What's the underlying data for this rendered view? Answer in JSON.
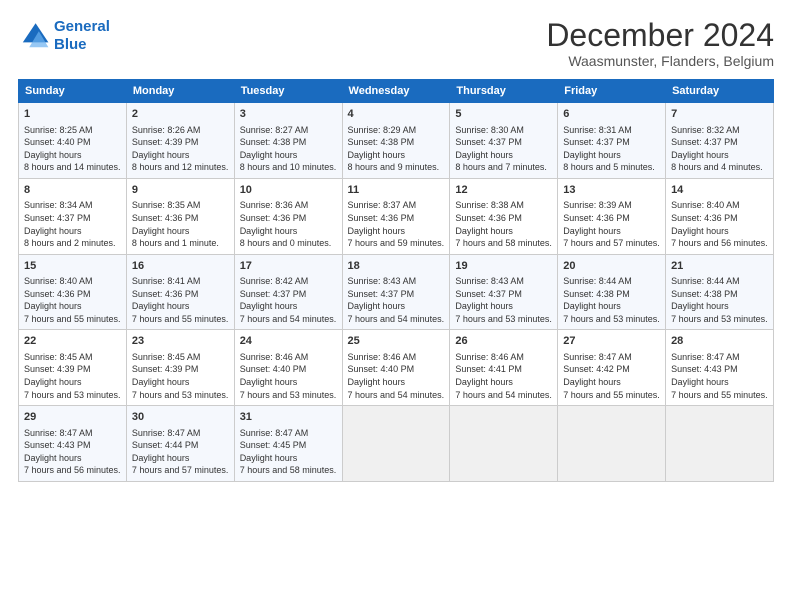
{
  "logo": {
    "line1": "General",
    "line2": "Blue"
  },
  "title": "December 2024",
  "subtitle": "Waasmunster, Flanders, Belgium",
  "days_of_week": [
    "Sunday",
    "Monday",
    "Tuesday",
    "Wednesday",
    "Thursday",
    "Friday",
    "Saturday"
  ],
  "weeks": [
    [
      {
        "day": "1",
        "sunrise": "8:25 AM",
        "sunset": "4:40 PM",
        "daylight": "8 hours and 14 minutes."
      },
      {
        "day": "2",
        "sunrise": "8:26 AM",
        "sunset": "4:39 PM",
        "daylight": "8 hours and 12 minutes."
      },
      {
        "day": "3",
        "sunrise": "8:27 AM",
        "sunset": "4:38 PM",
        "daylight": "8 hours and 10 minutes."
      },
      {
        "day": "4",
        "sunrise": "8:29 AM",
        "sunset": "4:38 PM",
        "daylight": "8 hours and 9 minutes."
      },
      {
        "day": "5",
        "sunrise": "8:30 AM",
        "sunset": "4:37 PM",
        "daylight": "8 hours and 7 minutes."
      },
      {
        "day": "6",
        "sunrise": "8:31 AM",
        "sunset": "4:37 PM",
        "daylight": "8 hours and 5 minutes."
      },
      {
        "day": "7",
        "sunrise": "8:32 AM",
        "sunset": "4:37 PM",
        "daylight": "8 hours and 4 minutes."
      }
    ],
    [
      {
        "day": "8",
        "sunrise": "8:34 AM",
        "sunset": "4:37 PM",
        "daylight": "8 hours and 2 minutes."
      },
      {
        "day": "9",
        "sunrise": "8:35 AM",
        "sunset": "4:36 PM",
        "daylight": "8 hours and 1 minute."
      },
      {
        "day": "10",
        "sunrise": "8:36 AM",
        "sunset": "4:36 PM",
        "daylight": "8 hours and 0 minutes."
      },
      {
        "day": "11",
        "sunrise": "8:37 AM",
        "sunset": "4:36 PM",
        "daylight": "7 hours and 59 minutes."
      },
      {
        "day": "12",
        "sunrise": "8:38 AM",
        "sunset": "4:36 PM",
        "daylight": "7 hours and 58 minutes."
      },
      {
        "day": "13",
        "sunrise": "8:39 AM",
        "sunset": "4:36 PM",
        "daylight": "7 hours and 57 minutes."
      },
      {
        "day": "14",
        "sunrise": "8:40 AM",
        "sunset": "4:36 PM",
        "daylight": "7 hours and 56 minutes."
      }
    ],
    [
      {
        "day": "15",
        "sunrise": "8:40 AM",
        "sunset": "4:36 PM",
        "daylight": "7 hours and 55 minutes."
      },
      {
        "day": "16",
        "sunrise": "8:41 AM",
        "sunset": "4:36 PM",
        "daylight": "7 hours and 55 minutes."
      },
      {
        "day": "17",
        "sunrise": "8:42 AM",
        "sunset": "4:37 PM",
        "daylight": "7 hours and 54 minutes."
      },
      {
        "day": "18",
        "sunrise": "8:43 AM",
        "sunset": "4:37 PM",
        "daylight": "7 hours and 54 minutes."
      },
      {
        "day": "19",
        "sunrise": "8:43 AM",
        "sunset": "4:37 PM",
        "daylight": "7 hours and 53 minutes."
      },
      {
        "day": "20",
        "sunrise": "8:44 AM",
        "sunset": "4:38 PM",
        "daylight": "7 hours and 53 minutes."
      },
      {
        "day": "21",
        "sunrise": "8:44 AM",
        "sunset": "4:38 PM",
        "daylight": "7 hours and 53 minutes."
      }
    ],
    [
      {
        "day": "22",
        "sunrise": "8:45 AM",
        "sunset": "4:39 PM",
        "daylight": "7 hours and 53 minutes."
      },
      {
        "day": "23",
        "sunrise": "8:45 AM",
        "sunset": "4:39 PM",
        "daylight": "7 hours and 53 minutes."
      },
      {
        "day": "24",
        "sunrise": "8:46 AM",
        "sunset": "4:40 PM",
        "daylight": "7 hours and 53 minutes."
      },
      {
        "day": "25",
        "sunrise": "8:46 AM",
        "sunset": "4:40 PM",
        "daylight": "7 hours and 54 minutes."
      },
      {
        "day": "26",
        "sunrise": "8:46 AM",
        "sunset": "4:41 PM",
        "daylight": "7 hours and 54 minutes."
      },
      {
        "day": "27",
        "sunrise": "8:47 AM",
        "sunset": "4:42 PM",
        "daylight": "7 hours and 55 minutes."
      },
      {
        "day": "28",
        "sunrise": "8:47 AM",
        "sunset": "4:43 PM",
        "daylight": "7 hours and 55 minutes."
      }
    ],
    [
      {
        "day": "29",
        "sunrise": "8:47 AM",
        "sunset": "4:43 PM",
        "daylight": "7 hours and 56 minutes."
      },
      {
        "day": "30",
        "sunrise": "8:47 AM",
        "sunset": "4:44 PM",
        "daylight": "7 hours and 57 minutes."
      },
      {
        "day": "31",
        "sunrise": "8:47 AM",
        "sunset": "4:45 PM",
        "daylight": "7 hours and 58 minutes."
      },
      null,
      null,
      null,
      null
    ]
  ]
}
